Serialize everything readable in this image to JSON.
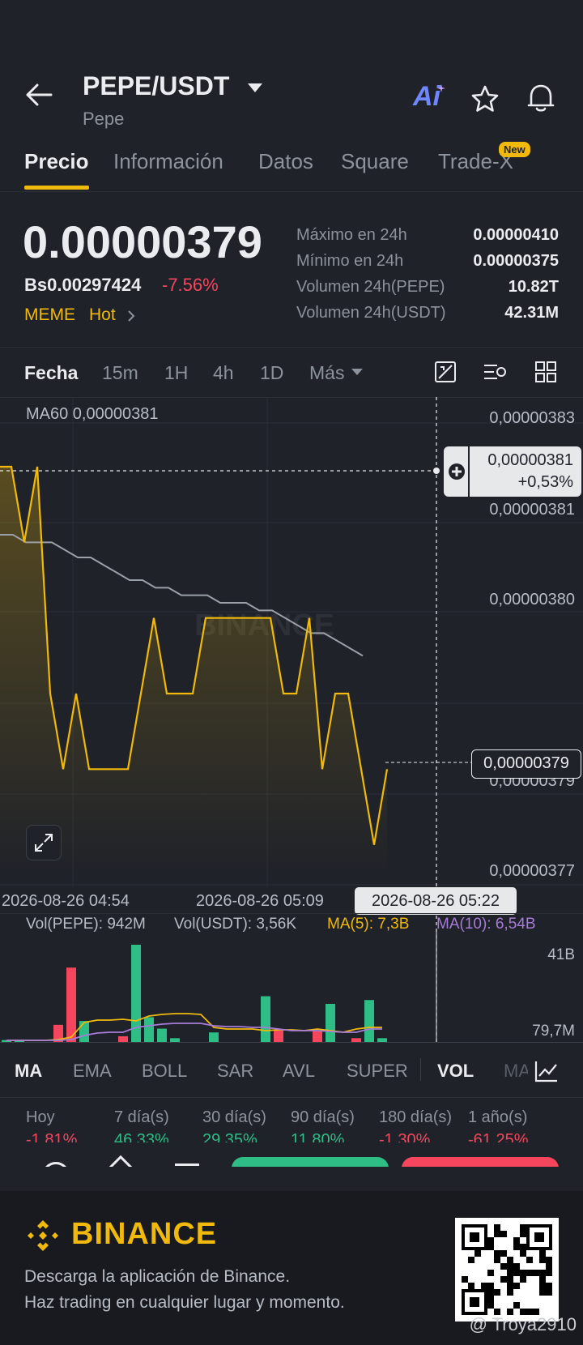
{
  "header": {
    "pair": "PEPE/USDT",
    "coin_name": "Pepe",
    "ai_label": "Ai",
    "tabs": [
      "Precio",
      "Información",
      "Datos",
      "Square",
      "Trade-X"
    ],
    "new_badge": "New"
  },
  "price_panel": {
    "last_price": "0.00000379",
    "fiat_value": "Bs0.00297424",
    "change_pct": "-7.56%",
    "tags": [
      "MEME",
      "Hot"
    ],
    "stats": [
      {
        "label": "Máximo en 24h",
        "value": "0.00000410"
      },
      {
        "label": "Mínimo en 24h",
        "value": "0.00000375"
      },
      {
        "label": "Volumen 24h(PEPE)",
        "value": "10.82T"
      },
      {
        "label": "Volumen 24h(USDT)",
        "value": "42.31M"
      }
    ]
  },
  "timeframes": {
    "items": [
      "Fecha",
      "15m",
      "1H",
      "4h",
      "1D",
      "Más"
    ],
    "active": "Fecha"
  },
  "chart": {
    "ma_label": "MA60 0,00000381",
    "watermark": "BINANCE",
    "crosshair_price": "0,00000381",
    "crosshair_change": "+0,53%",
    "current_price_tag": "0,00000379",
    "selected_time": "2026-08-26 05:22",
    "volume_header": {
      "vol_pepe": "Vol(PEPE): 942M",
      "vol_usdt": "Vol(USDT): 3,56K",
      "ma5": "MA(5): 7,3B",
      "ma10": "MA(10): 6,54B"
    },
    "volume_axis": [
      "41B",
      "79,7M"
    ],
    "colors": {
      "price_line": "#f0b90b",
      "ma60": "#9aa0a8",
      "up": "#2ebd85",
      "down": "#f6465d",
      "ma10": "#a67bd9"
    }
  },
  "chart_data": {
    "type": "line",
    "title": "",
    "y_ticks": [
      "0,00000383",
      "0,00000381",
      "0,00000380",
      "0,00000379",
      "0,00000377"
    ],
    "x_ticks": [
      "2026-08-26 04:54",
      "2026-08-26 05:09",
      "2026-08-26 05:22"
    ],
    "ylim": [
      3.771e-06,
      3.831e-06
    ],
    "series": [
      {
        "values": [
          3.825e-06,
          3.825e-06,
          3.815e-06,
          3.825e-06,
          3.795e-06,
          3.785e-06,
          3.795e-06,
          3.785e-06,
          3.785e-06,
          3.785e-06,
          3.785e-06,
          3.795e-06,
          3.805e-06,
          3.795e-06,
          3.795e-06,
          3.795e-06,
          3.805e-06,
          3.805e-06,
          3.805e-06,
          3.805e-06,
          3.805e-06,
          3.805e-06,
          3.795e-06,
          3.795e-06,
          3.805e-06,
          3.785e-06,
          3.795e-06,
          3.795e-06,
          3.785e-06,
          3.775e-06,
          3.785e-06
        ]
      },
      {
        "values": [
          3.816e-06,
          3.816e-06,
          3.815e-06,
          3.815e-06,
          3.815e-06,
          3.814e-06,
          3.813e-06,
          3.813e-06,
          3.812e-06,
          3.811e-06,
          3.81e-06,
          3.81e-06,
          3.809e-06,
          3.809e-06,
          3.808e-06,
          3.808e-06,
          3.808e-06,
          3.807e-06,
          3.807e-06,
          3.807e-06,
          3.806e-06,
          3.806e-06,
          3.805e-06,
          3.804e-06,
          3.803e-06,
          3.803e-06,
          3.802e-06,
          3.801e-06,
          3.8e-06
        ]
      }
    ]
  },
  "volume_data": {
    "bars": [
      {
        "v": 1,
        "up": true
      },
      {
        "v": 1,
        "up": true
      },
      {
        "v": 0,
        "up": true
      },
      {
        "v": 0,
        "up": true
      },
      {
        "v": 9,
        "up": false
      },
      {
        "v": 39,
        "up": false
      },
      {
        "v": 11,
        "up": true
      },
      {
        "v": 0,
        "up": true
      },
      {
        "v": 0,
        "up": true
      },
      {
        "v": 3,
        "up": false
      },
      {
        "v": 51,
        "up": true
      },
      {
        "v": 13,
        "up": true
      },
      {
        "v": 7,
        "up": true
      },
      {
        "v": 2,
        "up": true
      },
      {
        "v": 0,
        "up": true
      },
      {
        "v": 0,
        "up": true
      },
      {
        "v": 5,
        "up": true
      },
      {
        "v": 0,
        "up": true
      },
      {
        "v": 0,
        "up": true
      },
      {
        "v": 0,
        "up": true
      },
      {
        "v": 24,
        "up": true
      },
      {
        "v": 6,
        "up": false
      },
      {
        "v": 0,
        "up": true
      },
      {
        "v": 0,
        "up": true
      },
      {
        "v": 6,
        "up": false
      },
      {
        "v": 20,
        "up": true
      },
      {
        "v": 0,
        "up": true
      },
      {
        "v": 2,
        "up": false
      },
      {
        "v": 22,
        "up": true
      },
      {
        "v": 2,
        "up": true
      }
    ]
  },
  "indicator_tabs": {
    "items": [
      "MA",
      "EMA",
      "BOLL",
      "SAR",
      "AVL",
      "SUPER",
      "VOL",
      "MA"
    ],
    "active": [
      "MA",
      "VOL"
    ]
  },
  "performance": [
    {
      "label": "Hoy",
      "value": "-1,81%",
      "up": false
    },
    {
      "label": "7 día(s)",
      "value": "46,33%",
      "up": true
    },
    {
      "label": "30 día(s)",
      "value": "29,35%",
      "up": true
    },
    {
      "label": "90 día(s)",
      "value": "11,80%",
      "up": true
    },
    {
      "label": "180 día(s)",
      "value": "-1,30%",
      "up": false
    },
    {
      "label": "1 año(s)",
      "value": "-61,25%",
      "up": false
    }
  ],
  "footer": {
    "brand": "BINANCE",
    "line1": "Descarga la aplicación de Binance.",
    "line2": "Haz trading en cualquier lugar y momento.",
    "watermark": "@ Troya2910"
  }
}
